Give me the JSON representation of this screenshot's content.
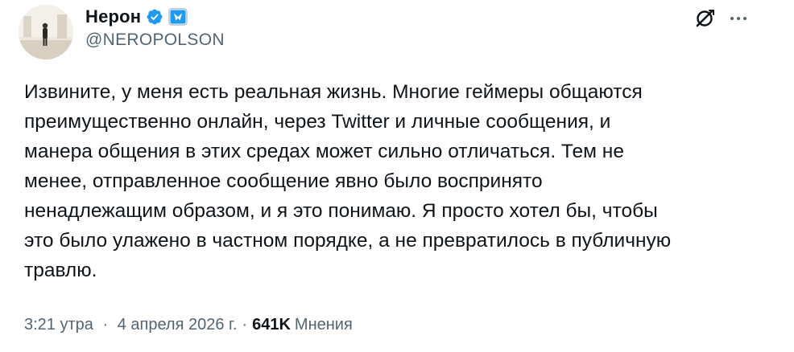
{
  "author": {
    "display_name": "Нерон",
    "handle": "@NEROPOLSON",
    "verified": true,
    "accent_color": "#1d9bf0"
  },
  "actions": {
    "grok_icon": "grok-icon",
    "more_icon": "more-horizontal-icon"
  },
  "tweet": {
    "lines": [
      "Извините, у меня есть реальная жизнь. Многие геймеры общаются",
      "преимущественно онлайн, через Twitter и личные сообщения, и",
      "манера общения в этих средах может сильно отличаться. Тем не",
      "менее, отправленное сообщение явно было воспринято",
      "ненадлежащим образом, и я это понимаю. Я просто хотел бы, чтобы",
      "это было улажено в частном порядке, а не превратилось в публичную",
      "травлю."
    ]
  },
  "meta": {
    "time": "3:21 утра",
    "separator": "·",
    "date": "4 апреля 2026 г.",
    "views_count": "641K",
    "views_label": "Мнения"
  }
}
